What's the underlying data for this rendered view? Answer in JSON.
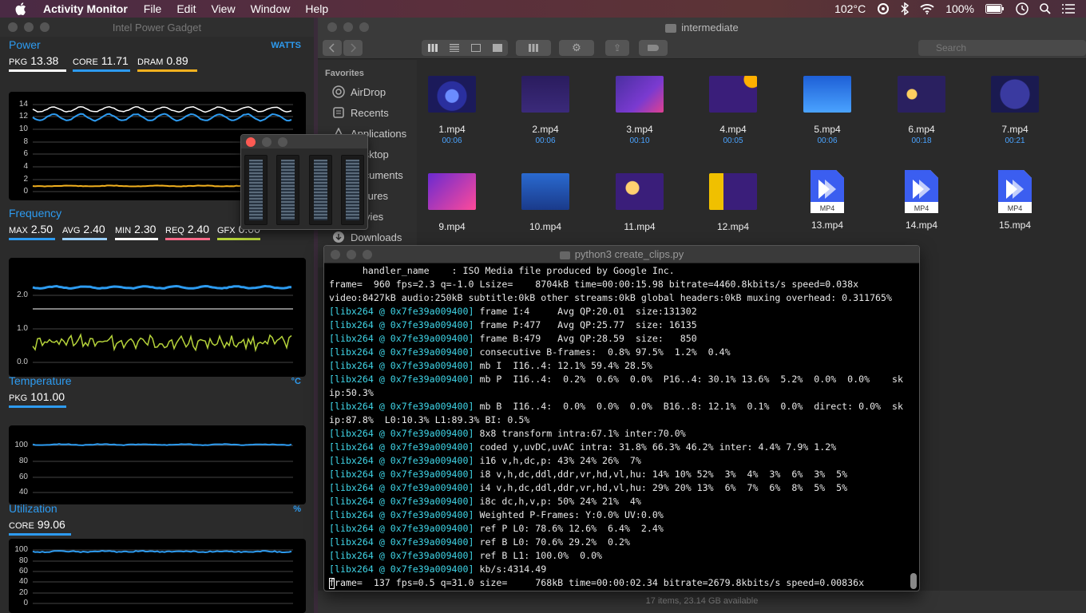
{
  "menubar": {
    "app": "Activity Monitor",
    "items": [
      "File",
      "Edit",
      "View",
      "Window",
      "Help"
    ],
    "temp": "102°C",
    "battery": "100%"
  },
  "gadget": {
    "title": "Intel Power Gadget",
    "power": {
      "label": "Power",
      "unit": "WATTS",
      "pkg_label": "PKG",
      "pkg": "13.38",
      "core_label": "CORE",
      "core": "11.71",
      "dram_label": "DRAM",
      "dram": "0.89",
      "ticks": [
        "14",
        "12",
        "10",
        "8",
        "6",
        "4",
        "2",
        "0"
      ]
    },
    "frequency": {
      "label": "Frequency",
      "max_label": "MAX",
      "max": "2.50",
      "avg_label": "AVG",
      "avg": "2.40",
      "min_label": "MIN",
      "min": "2.30",
      "req_label": "REQ",
      "req": "2.40",
      "gfx_label": "GFX",
      "gfx": "0.00",
      "ticks": [
        "2.0",
        "1.0",
        "0.0"
      ]
    },
    "temperature": {
      "label": "Temperature",
      "unit": "°C",
      "pkg_label": "PKG",
      "pkg": "101.00",
      "ticks": [
        "100",
        "80",
        "60",
        "40"
      ]
    },
    "utilization": {
      "label": "Utilization",
      "unit": "%",
      "core_label": "CORE",
      "core": "99.06",
      "ticks": [
        "100",
        "80",
        "60",
        "40",
        "20",
        "0"
      ]
    }
  },
  "finder": {
    "title": "intermediate",
    "search_placeholder": "Search",
    "sidebar_heading": "Favorites",
    "sidebar": [
      "AirDrop",
      "Recents",
      "Applications",
      "Desktop",
      "Documents",
      "Pictures",
      "Movies",
      "Downloads"
    ],
    "files": [
      {
        "name": "1.mp4",
        "dur": "00:06"
      },
      {
        "name": "2.mp4",
        "dur": "00:06"
      },
      {
        "name": "3.mp4",
        "dur": "00:10"
      },
      {
        "name": "4.mp4",
        "dur": "00:05"
      },
      {
        "name": "5.mp4",
        "dur": "00:06"
      },
      {
        "name": "6.mp4",
        "dur": "00:18"
      },
      {
        "name": "7.mp4",
        "dur": "00:21"
      },
      {
        "name": "9.mp4"
      },
      {
        "name": "10.mp4"
      },
      {
        "name": "11.mp4"
      },
      {
        "name": "12.mp4"
      },
      {
        "name": "13.mp4"
      },
      {
        "name": "14.mp4"
      },
      {
        "name": "15.mp4"
      }
    ],
    "doc_badge": "MP4",
    "status": "17 items, 23.14 GB available"
  },
  "terminal": {
    "title": "python3 create_clips.py",
    "lines": [
      {
        "text": "      handler_name    : ISO Media file produced by Google Inc."
      },
      {
        "text": "frame=  960 fps=2.3 q=-1.0 Lsize=    8704kB time=00:00:15.98 bitrate=4460.8kbits/s speed=0.038x"
      },
      {
        "text": "video:8427kB audio:250kB subtitle:0kB other streams:0kB global headers:0kB muxing overhead: 0.311765%"
      },
      {
        "tag": "[libx264 @ 0x7fe39a009400]",
        "text": " frame I:4     Avg QP:20.01  size:131302"
      },
      {
        "tag": "[libx264 @ 0x7fe39a009400]",
        "text": " frame P:477   Avg QP:25.77  size: 16135"
      },
      {
        "tag": "[libx264 @ 0x7fe39a009400]",
        "text": " frame B:479   Avg QP:28.59  size:   850"
      },
      {
        "tag": "[libx264 @ 0x7fe39a009400]",
        "text": " consecutive B-frames:  0.8% 97.5%  1.2%  0.4%"
      },
      {
        "tag": "[libx264 @ 0x7fe39a009400]",
        "text": " mb I  I16..4: 12.1% 59.4% 28.5%"
      },
      {
        "tag": "[libx264 @ 0x7fe39a009400]",
        "text": " mb P  I16..4:  0.2%  0.6%  0.0%  P16..4: 30.1% 13.6%  5.2%  0.0%  0.0%    sk"
      },
      {
        "text": "ip:50.3%"
      },
      {
        "tag": "[libx264 @ 0x7fe39a009400]",
        "text": " mb B  I16..4:  0.0%  0.0%  0.0%  B16..8: 12.1%  0.1%  0.0%  direct: 0.0%  sk"
      },
      {
        "text": "ip:87.8%  L0:10.3% L1:89.3% BI: 0.5%"
      },
      {
        "tag": "[libx264 @ 0x7fe39a009400]",
        "text": " 8x8 transform intra:67.1% inter:70.0%"
      },
      {
        "tag": "[libx264 @ 0x7fe39a009400]",
        "text": " coded y,uvDC,uvAC intra: 31.8% 66.3% 46.2% inter: 4.4% 7.9% 1.2%"
      },
      {
        "tag": "[libx264 @ 0x7fe39a009400]",
        "text": " i16 v,h,dc,p: 43% 24% 26%  7%"
      },
      {
        "tag": "[libx264 @ 0x7fe39a009400]",
        "text": " i8 v,h,dc,ddl,ddr,vr,hd,vl,hu: 14% 10% 52%  3%  4%  3%  6%  3%  5%"
      },
      {
        "tag": "[libx264 @ 0x7fe39a009400]",
        "text": " i4 v,h,dc,ddl,ddr,vr,hd,vl,hu: 29% 20% 13%  6%  7%  6%  8%  5%  5%"
      },
      {
        "tag": "[libx264 @ 0x7fe39a009400]",
        "text": " i8c dc,h,v,p: 50% 24% 21%  4%"
      },
      {
        "tag": "[libx264 @ 0x7fe39a009400]",
        "text": " Weighted P-Frames: Y:0.0% UV:0.0%"
      },
      {
        "tag": "[libx264 @ 0x7fe39a009400]",
        "text": " ref P L0: 78.6% 12.6%  6.4%  2.4%"
      },
      {
        "tag": "[libx264 @ 0x7fe39a009400]",
        "text": " ref B L0: 70.6% 29.2%  0.2%"
      },
      {
        "tag": "[libx264 @ 0x7fe39a009400]",
        "text": " ref B L1: 100.0%  0.0%"
      },
      {
        "tag": "[libx264 @ 0x7fe39a009400]",
        "text": " kb/s:4314.49"
      },
      {
        "text": "frame=  137 fps=0.5 q=31.0 size=     768kB time=00:00:02.34 bitrate=2679.8kbits/s speed=0.00836x",
        "cursor": true
      }
    ]
  }
}
